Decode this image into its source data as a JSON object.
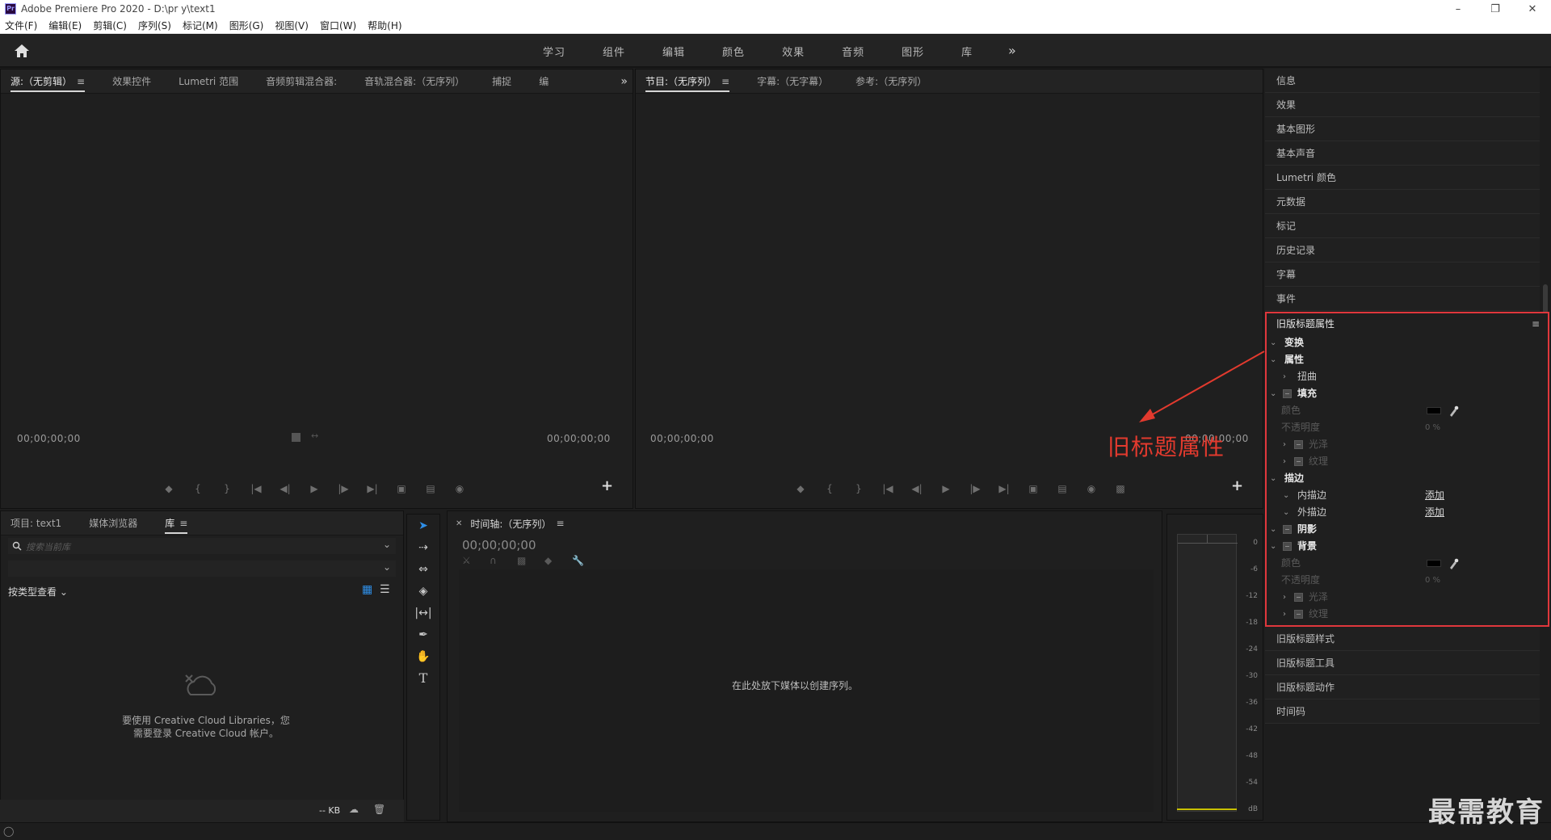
{
  "window": {
    "title": "Adobe Premiere Pro 2020 - D:\\pr y\\text1",
    "app_icon": "Pr",
    "controls": [
      "minimize",
      "maximize",
      "close"
    ]
  },
  "menu": [
    "文件(F)",
    "编辑(E)",
    "剪辑(C)",
    "序列(S)",
    "标记(M)",
    "图形(G)",
    "视图(V)",
    "窗口(W)",
    "帮助(H)"
  ],
  "workspaces": [
    "学习",
    "组件",
    "编辑",
    "颜色",
    "效果",
    "音频",
    "图形",
    "库"
  ],
  "source_panel": {
    "tabs": [
      "源:（无剪辑）",
      "效果控件",
      "Lumetri 范围",
      "音频剪辑混合器:",
      "音轨混合器:（无序列）",
      "捕捉",
      "编"
    ],
    "timecode_left": "00;00;00;00",
    "timecode_right": "00;00;00;00"
  },
  "program_panel": {
    "tabs": [
      "节目:（无序列）",
      "字幕:（无字幕）",
      "参考:（无序列）"
    ],
    "timecode_left": "00;00;00;00",
    "timecode_right": "00;00;00;00"
  },
  "right_list": [
    "信息",
    "效果",
    "基本图形",
    "基本声音",
    "Lumetri 颜色",
    "元数据",
    "标记",
    "历史记录",
    "字幕",
    "事件"
  ],
  "legacy_props": {
    "title": "旧版标题属性",
    "rows": [
      {
        "label": "变换"
      },
      {
        "label": "属性"
      },
      {
        "label": "扭曲"
      },
      {
        "label": "填充"
      },
      {
        "label": "颜色"
      },
      {
        "label": "不透明度",
        "value": "0 %"
      },
      {
        "label": "光泽"
      },
      {
        "label": "纹理"
      },
      {
        "label": "描边"
      },
      {
        "label": "内描边",
        "action": "添加"
      },
      {
        "label": "外描边",
        "action": "添加"
      },
      {
        "label": "阴影"
      },
      {
        "label": "背景"
      },
      {
        "label": "颜色"
      },
      {
        "label": "不透明度",
        "value": "0 %"
      },
      {
        "label": "光泽"
      },
      {
        "label": "纹理"
      }
    ]
  },
  "right_list_bottom": [
    "旧版标题样式",
    "旧版标题工具",
    "旧版标题动作",
    "时间码"
  ],
  "annotation": "旧标题属性",
  "project_panel": {
    "tabs": [
      "项目: text1",
      "媒体浏览器",
      "库"
    ],
    "search_placeholder": "搜索当前库",
    "view_by": "按类型查看",
    "cc_message_line1": "要使用 Creative Cloud Libraries，您",
    "cc_message_line2": "需要登录 Creative Cloud 帐户。",
    "size": "-- KB"
  },
  "timeline": {
    "title": "时间轴:（无序列）",
    "timecode": "00;00;00;00",
    "empty_message": "在此处放下媒体以创建序列。"
  },
  "meter_labels": [
    "0",
    "-6",
    "-12",
    "-18",
    "-24",
    "-30",
    "-36",
    "-42",
    "-48",
    "-54",
    "dB"
  ],
  "watermark": "最需教育"
}
